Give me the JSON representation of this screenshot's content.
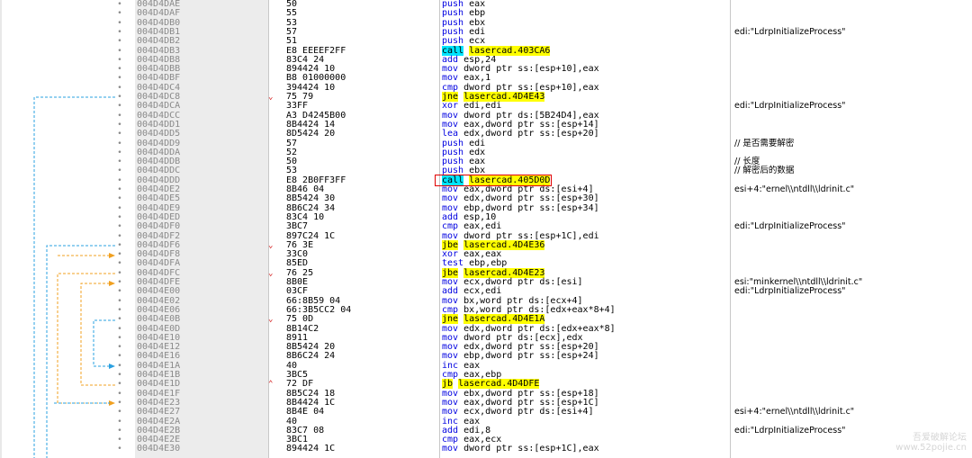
{
  "rows": [
    {
      "addr": "004D4DAE",
      "bytes": "50",
      "mnem": "push",
      "ops": "eax",
      "comment": ""
    },
    {
      "addr": "004D4DAF",
      "bytes": "55",
      "mnem": "push",
      "ops": "ebp",
      "comment": ""
    },
    {
      "addr": "004D4DB0",
      "bytes": "53",
      "mnem": "push",
      "ops": "ebx",
      "comment": ""
    },
    {
      "addr": "004D4DB1",
      "bytes": "57",
      "mnem": "push",
      "ops": "edi",
      "comment": "edi:\"LdrpInitializeProcess\""
    },
    {
      "addr": "004D4DB2",
      "bytes": "51",
      "mnem": "push",
      "ops": "ecx",
      "comment": ""
    },
    {
      "addr": "004D4DB3",
      "bytes": "E8 EEEEF2FF",
      "mnem": "call",
      "ops": "lasercad.403CA6",
      "comment": "",
      "hl": "call"
    },
    {
      "addr": "004D4DB8",
      "bytes": "83C4 24",
      "mnem": "add",
      "ops": "esp,24",
      "comment": ""
    },
    {
      "addr": "004D4DBB",
      "bytes": "894424 10",
      "mnem": "mov",
      "ops": "dword ptr ss:[esp+10],eax",
      "comment": ""
    },
    {
      "addr": "004D4DBF",
      "bytes": "B8 01000000",
      "mnem": "mov",
      "ops": "eax,1",
      "comment": ""
    },
    {
      "addr": "004D4DC4",
      "bytes": "394424 10",
      "mnem": "cmp",
      "ops": "dword ptr ss:[esp+10],eax",
      "comment": ""
    },
    {
      "addr": "004D4DC8",
      "bytes": "75 79",
      "mnem": "jne",
      "ops": "lasercad.4D4E43",
      "comment": "",
      "hl": "jmp",
      "mark": "v"
    },
    {
      "addr": "004D4DCA",
      "bytes": "33FF",
      "mnem": "xor",
      "ops": "edi,edi",
      "comment": "edi:\"LdrpInitializeProcess\""
    },
    {
      "addr": "004D4DCC",
      "bytes": "A3 D4245B00",
      "mnem": "mov",
      "ops": "dword ptr ds:[5B24D4],eax",
      "comment": ""
    },
    {
      "addr": "004D4DD1",
      "bytes": "8B4424 14",
      "mnem": "mov",
      "ops": "eax,dword ptr ss:[esp+14]",
      "comment": ""
    },
    {
      "addr": "004D4DD5",
      "bytes": "8D5424 20",
      "mnem": "lea",
      "ops": "edx,dword ptr ss:[esp+20]",
      "comment": ""
    },
    {
      "addr": "004D4DD9",
      "bytes": "57",
      "mnem": "push",
      "ops": "edi",
      "comment": "// 是否需要解密"
    },
    {
      "addr": "004D4DDA",
      "bytes": "52",
      "mnem": "push",
      "ops": "edx",
      "comment": ""
    },
    {
      "addr": "004D4DDB",
      "bytes": "50",
      "mnem": "push",
      "ops": "eax",
      "comment": "// 长度"
    },
    {
      "addr": "004D4DDC",
      "bytes": "53",
      "mnem": "push",
      "ops": "ebx",
      "comment": "// 解密后的数据"
    },
    {
      "addr": "004D4DDD",
      "bytes": "E8 2B0FF3FF",
      "mnem": "call",
      "ops": "lasercad.405D0D",
      "comment": "",
      "hl": "call"
    },
    {
      "addr": "004D4DE2",
      "bytes": "8B46 04",
      "mnem": "mov",
      "ops": "eax,dword ptr ds:[esi+4]",
      "comment": "esi+4:\"ernel\\\\ntdll\\\\ldrinit.c\""
    },
    {
      "addr": "004D4DE5",
      "bytes": "8B5424 30",
      "mnem": "mov",
      "ops": "edx,dword ptr ss:[esp+30]",
      "comment": ""
    },
    {
      "addr": "004D4DE9",
      "bytes": "8B6C24 34",
      "mnem": "mov",
      "ops": "ebp,dword ptr ss:[esp+34]",
      "comment": ""
    },
    {
      "addr": "004D4DED",
      "bytes": "83C4 10",
      "mnem": "add",
      "ops": "esp,10",
      "comment": ""
    },
    {
      "addr": "004D4DF0",
      "bytes": "3BC7",
      "mnem": "cmp",
      "ops": "eax,edi",
      "comment": "edi:\"LdrpInitializeProcess\""
    },
    {
      "addr": "004D4DF2",
      "bytes": "897C24 1C",
      "mnem": "mov",
      "ops": "dword ptr ss:[esp+1C],edi",
      "comment": ""
    },
    {
      "addr": "004D4DF6",
      "bytes": "76 3E",
      "mnem": "jbe",
      "ops": "lasercad.4D4E36",
      "comment": "",
      "hl": "jmp",
      "mark": "v"
    },
    {
      "addr": "004D4DF8",
      "bytes": "33C0",
      "mnem": "xor",
      "ops": "eax,eax",
      "comment": ""
    },
    {
      "addr": "004D4DFA",
      "bytes": "85ED",
      "mnem": "test",
      "ops": "ebp,ebp",
      "comment": ""
    },
    {
      "addr": "004D4DFC",
      "bytes": "76 25",
      "mnem": "jbe",
      "ops": "lasercad.4D4E23",
      "comment": "",
      "hl": "jmp",
      "mark": "v"
    },
    {
      "addr": "004D4DFE",
      "bytes": "8B0E",
      "mnem": "mov",
      "ops": "ecx,dword ptr ds:[esi]",
      "comment": "esi:\"minkernel\\\\ntdll\\\\ldrinit.c\""
    },
    {
      "addr": "004D4E00",
      "bytes": "03CF",
      "mnem": "add",
      "ops": "ecx,edi",
      "comment": "edi:\"LdrpInitializeProcess\""
    },
    {
      "addr": "004D4E02",
      "bytes": "66:8B59 04",
      "mnem": "mov",
      "ops": "bx,word ptr ds:[ecx+4]",
      "comment": ""
    },
    {
      "addr": "004D4E06",
      "bytes": "66:3B5CC2 04",
      "mnem": "cmp",
      "ops": "bx,word ptr ds:[edx+eax*8+4]",
      "comment": ""
    },
    {
      "addr": "004D4E0B",
      "bytes": "75 0D",
      "mnem": "jne",
      "ops": "lasercad.4D4E1A",
      "comment": "",
      "hl": "jmp",
      "mark": "v"
    },
    {
      "addr": "004D4E0D",
      "bytes": "8B14C2",
      "mnem": "mov",
      "ops": "edx,dword ptr ds:[edx+eax*8]",
      "comment": ""
    },
    {
      "addr": "004D4E10",
      "bytes": "8911",
      "mnem": "mov",
      "ops": "dword ptr ds:[ecx],edx",
      "comment": ""
    },
    {
      "addr": "004D4E12",
      "bytes": "8B5424 20",
      "mnem": "mov",
      "ops": "edx,dword ptr ss:[esp+20]",
      "comment": ""
    },
    {
      "addr": "004D4E16",
      "bytes": "8B6C24 24",
      "mnem": "mov",
      "ops": "ebp,dword ptr ss:[esp+24]",
      "comment": ""
    },
    {
      "addr": "004D4E1A",
      "bytes": "40",
      "mnem": "inc",
      "ops": "eax",
      "comment": ""
    },
    {
      "addr": "004D4E1B",
      "bytes": "3BC5",
      "mnem": "cmp",
      "ops": "eax,ebp",
      "comment": ""
    },
    {
      "addr": "004D4E1D",
      "bytes": "72 DF",
      "mnem": "jb",
      "ops": "lasercad.4D4DFE",
      "comment": "",
      "hl": "jmp",
      "mark": "^"
    },
    {
      "addr": "004D4E1F",
      "bytes": "8B5C24 18",
      "mnem": "mov",
      "ops": "ebx,dword ptr ss:[esp+18]",
      "comment": ""
    },
    {
      "addr": "004D4E23",
      "bytes": "8B4424 1C",
      "mnem": "mov",
      "ops": "eax,dword ptr ss:[esp+1C]",
      "comment": ""
    },
    {
      "addr": "004D4E27",
      "bytes": "8B4E 04",
      "mnem": "mov",
      "ops": "ecx,dword ptr ds:[esi+4]",
      "comment": "esi+4:\"ernel\\\\ntdll\\\\ldrinit.c\""
    },
    {
      "addr": "004D4E2A",
      "bytes": "40",
      "mnem": "inc",
      "ops": "eax",
      "comment": ""
    },
    {
      "addr": "004D4E2B",
      "bytes": "83C7 08",
      "mnem": "add",
      "ops": "edi,8",
      "comment": "edi:\"LdrpInitializeProcess\""
    },
    {
      "addr": "004D4E2E",
      "bytes": "3BC1",
      "mnem": "cmp",
      "ops": "eax,ecx",
      "comment": ""
    },
    {
      "addr": "004D4E30",
      "bytes": "894424 1C",
      "mnem": "mov",
      "ops": "dword ptr ss:[esp+1C],eax",
      "comment": ""
    }
  ],
  "watermark": {
    "line1": "吾爱破解论坛",
    "line2": "www.52pojie.cn"
  }
}
